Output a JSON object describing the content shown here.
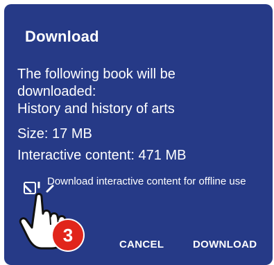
{
  "dialog": {
    "title": "Download",
    "message_line1": "The following book will be",
    "message_line2": "downloaded:",
    "book_title": "History and history of arts",
    "size": "Size: 17 MB",
    "interactive_content": "Interactive content: 471 MB",
    "checkbox_label": "Download interactive content for offline use",
    "checkbox_checked": false,
    "cancel_label": "CANCEL",
    "download_label": "DOWNLOAD"
  },
  "overlay": {
    "step_number": "3",
    "pointer_icon": "hand-pointer-icon"
  },
  "colors": {
    "dialog_background": "#263a87",
    "text": "#ffffff",
    "step_badge": "#e1251b"
  }
}
